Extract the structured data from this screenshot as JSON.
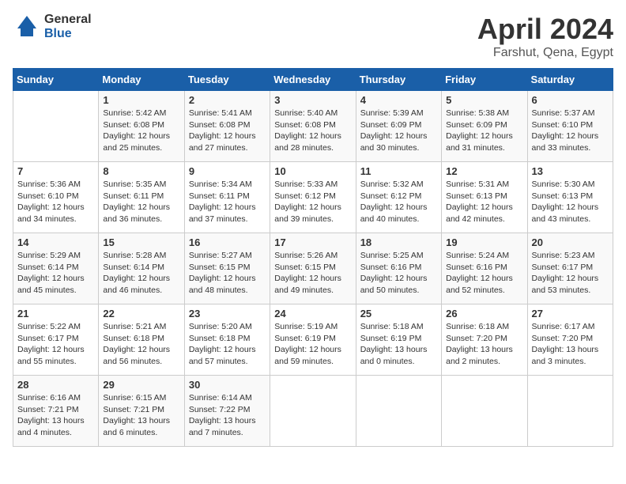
{
  "header": {
    "logo_general": "General",
    "logo_blue": "Blue",
    "title": "April 2024",
    "subtitle": "Farshut, Qena, Egypt"
  },
  "days_of_week": [
    "Sunday",
    "Monday",
    "Tuesday",
    "Wednesday",
    "Thursday",
    "Friday",
    "Saturday"
  ],
  "weeks": [
    [
      {
        "day": "",
        "info": ""
      },
      {
        "day": "1",
        "info": "Sunrise: 5:42 AM\nSunset: 6:08 PM\nDaylight: 12 hours\nand 25 minutes."
      },
      {
        "day": "2",
        "info": "Sunrise: 5:41 AM\nSunset: 6:08 PM\nDaylight: 12 hours\nand 27 minutes."
      },
      {
        "day": "3",
        "info": "Sunrise: 5:40 AM\nSunset: 6:08 PM\nDaylight: 12 hours\nand 28 minutes."
      },
      {
        "day": "4",
        "info": "Sunrise: 5:39 AM\nSunset: 6:09 PM\nDaylight: 12 hours\nand 30 minutes."
      },
      {
        "day": "5",
        "info": "Sunrise: 5:38 AM\nSunset: 6:09 PM\nDaylight: 12 hours\nand 31 minutes."
      },
      {
        "day": "6",
        "info": "Sunrise: 5:37 AM\nSunset: 6:10 PM\nDaylight: 12 hours\nand 33 minutes."
      }
    ],
    [
      {
        "day": "7",
        "info": "Sunrise: 5:36 AM\nSunset: 6:10 PM\nDaylight: 12 hours\nand 34 minutes."
      },
      {
        "day": "8",
        "info": "Sunrise: 5:35 AM\nSunset: 6:11 PM\nDaylight: 12 hours\nand 36 minutes."
      },
      {
        "day": "9",
        "info": "Sunrise: 5:34 AM\nSunset: 6:11 PM\nDaylight: 12 hours\nand 37 minutes."
      },
      {
        "day": "10",
        "info": "Sunrise: 5:33 AM\nSunset: 6:12 PM\nDaylight: 12 hours\nand 39 minutes."
      },
      {
        "day": "11",
        "info": "Sunrise: 5:32 AM\nSunset: 6:12 PM\nDaylight: 12 hours\nand 40 minutes."
      },
      {
        "day": "12",
        "info": "Sunrise: 5:31 AM\nSunset: 6:13 PM\nDaylight: 12 hours\nand 42 minutes."
      },
      {
        "day": "13",
        "info": "Sunrise: 5:30 AM\nSunset: 6:13 PM\nDaylight: 12 hours\nand 43 minutes."
      }
    ],
    [
      {
        "day": "14",
        "info": "Sunrise: 5:29 AM\nSunset: 6:14 PM\nDaylight: 12 hours\nand 45 minutes."
      },
      {
        "day": "15",
        "info": "Sunrise: 5:28 AM\nSunset: 6:14 PM\nDaylight: 12 hours\nand 46 minutes."
      },
      {
        "day": "16",
        "info": "Sunrise: 5:27 AM\nSunset: 6:15 PM\nDaylight: 12 hours\nand 48 minutes."
      },
      {
        "day": "17",
        "info": "Sunrise: 5:26 AM\nSunset: 6:15 PM\nDaylight: 12 hours\nand 49 minutes."
      },
      {
        "day": "18",
        "info": "Sunrise: 5:25 AM\nSunset: 6:16 PM\nDaylight: 12 hours\nand 50 minutes."
      },
      {
        "day": "19",
        "info": "Sunrise: 5:24 AM\nSunset: 6:16 PM\nDaylight: 12 hours\nand 52 minutes."
      },
      {
        "day": "20",
        "info": "Sunrise: 5:23 AM\nSunset: 6:17 PM\nDaylight: 12 hours\nand 53 minutes."
      }
    ],
    [
      {
        "day": "21",
        "info": "Sunrise: 5:22 AM\nSunset: 6:17 PM\nDaylight: 12 hours\nand 55 minutes."
      },
      {
        "day": "22",
        "info": "Sunrise: 5:21 AM\nSunset: 6:18 PM\nDaylight: 12 hours\nand 56 minutes."
      },
      {
        "day": "23",
        "info": "Sunrise: 5:20 AM\nSunset: 6:18 PM\nDaylight: 12 hours\nand 57 minutes."
      },
      {
        "day": "24",
        "info": "Sunrise: 5:19 AM\nSunset: 6:19 PM\nDaylight: 12 hours\nand 59 minutes."
      },
      {
        "day": "25",
        "info": "Sunrise: 5:18 AM\nSunset: 6:19 PM\nDaylight: 13 hours\nand 0 minutes."
      },
      {
        "day": "26",
        "info": "Sunrise: 6:18 AM\nSunset: 7:20 PM\nDaylight: 13 hours\nand 2 minutes."
      },
      {
        "day": "27",
        "info": "Sunrise: 6:17 AM\nSunset: 7:20 PM\nDaylight: 13 hours\nand 3 minutes."
      }
    ],
    [
      {
        "day": "28",
        "info": "Sunrise: 6:16 AM\nSunset: 7:21 PM\nDaylight: 13 hours\nand 4 minutes."
      },
      {
        "day": "29",
        "info": "Sunrise: 6:15 AM\nSunset: 7:21 PM\nDaylight: 13 hours\nand 6 minutes."
      },
      {
        "day": "30",
        "info": "Sunrise: 6:14 AM\nSunset: 7:22 PM\nDaylight: 13 hours\nand 7 minutes."
      },
      {
        "day": "",
        "info": ""
      },
      {
        "day": "",
        "info": ""
      },
      {
        "day": "",
        "info": ""
      },
      {
        "day": "",
        "info": ""
      }
    ]
  ]
}
